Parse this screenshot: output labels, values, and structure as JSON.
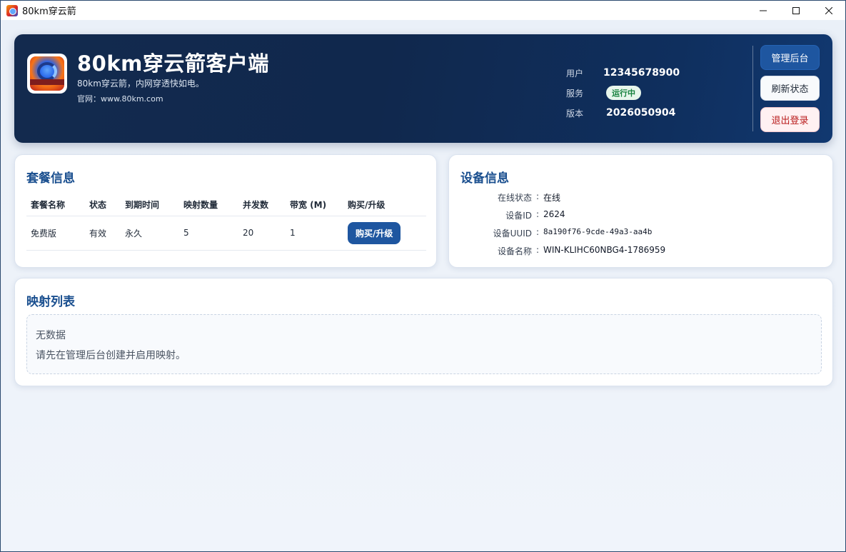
{
  "window": {
    "title": "80km穿云箭",
    "icon": "app-logo-icon",
    "controls": [
      "minimize-icon",
      "maximize-icon",
      "close-icon"
    ]
  },
  "header": {
    "title": "80km穿云箭客户端",
    "subtitle": "80km穿云箭，内网穿透快如电。",
    "website": "官网：www.80km.com",
    "meta": {
      "user_label": "用户",
      "user_value": "12345678900",
      "service_label": "服务",
      "service_status": "运行中",
      "version_label": "版本",
      "version_value": "2026050904"
    },
    "buttons": {
      "admin": "管理后台",
      "refresh": "刷新状态",
      "logout": "退出登录"
    }
  },
  "plan": {
    "title": "套餐信息",
    "columns": [
      "套餐名称",
      "状态",
      "到期时间",
      "映射数量",
      "并发数",
      "带宽 (M)",
      "购买/升级"
    ],
    "rows": [
      {
        "name": "免费版",
        "status": "有效",
        "expiry": "永久",
        "mappings": "5",
        "concurrency": "20",
        "bandwidth": "1",
        "action": "购买/升级"
      }
    ]
  },
  "device": {
    "title": "设备信息",
    "separator": ":",
    "fields": [
      {
        "label": "在线状态",
        "value": "在线"
      },
      {
        "label": "设备ID",
        "value": "2624"
      },
      {
        "label": "设备UUID",
        "value": "8a190f76-9cde-49a3-aa4b"
      },
      {
        "label": "设备名称",
        "value": "WIN-KLIHC60NBG4-1786959"
      }
    ]
  },
  "mapping": {
    "title": "映射列表",
    "empty_title": "无数据",
    "empty_desc": "请先在管理后台创建并启用映射。"
  },
  "colors": {
    "brand": "#1e56a0",
    "hero_bg": "#132a4e",
    "title_accent": "#1a4f8f",
    "status_ok_bg": "#e7f6ec",
    "status_ok_text": "#15803d",
    "danger": "#b91c1c"
  }
}
